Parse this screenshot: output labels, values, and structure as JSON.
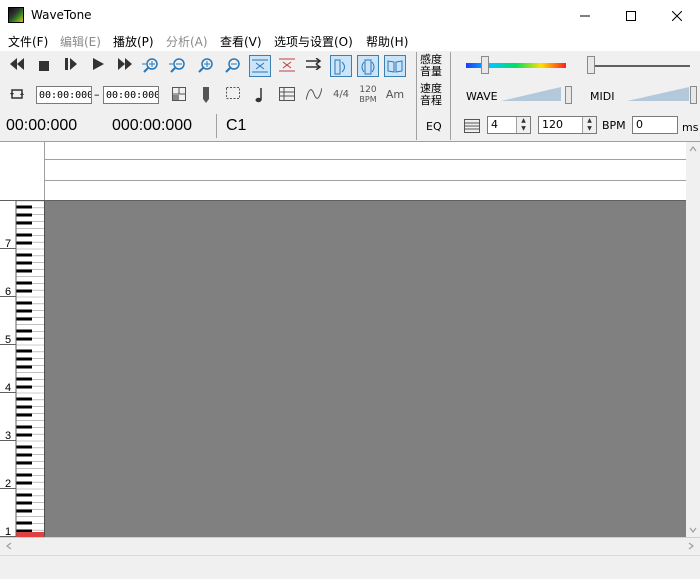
{
  "window": {
    "title": "WaveTone",
    "controls": [
      "minimize",
      "maximize",
      "close"
    ]
  },
  "menu": [
    {
      "label": "文件(F)",
      "enabled": true
    },
    {
      "label": "编辑(E)",
      "enabled": false
    },
    {
      "label": "播放(P)",
      "enabled": true
    },
    {
      "label": "分析(A)",
      "enabled": false
    },
    {
      "label": "查看(V)",
      "enabled": true
    },
    {
      "label": "选项与设置(O)",
      "enabled": true
    },
    {
      "label": "帮助(H)",
      "enabled": true
    }
  ],
  "toolbar": {
    "icons": [
      "rewind-icon",
      "stop-icon",
      "pause-play-icon",
      "play-icon",
      "fast-forward-icon",
      "zoom-in-horizontal-icon",
      "zoom-out-horizontal-icon",
      "zoom-in-vertical-icon",
      "zoom-out-vertical-icon",
      "fit-horizontal-icon",
      "fit-vertical-icon",
      "follow-icon",
      "speaker-left-icon",
      "speaker-both-icon",
      "book-icon"
    ],
    "loop_start": "00:00:000",
    "loop_end": "00:00:000",
    "separator": "–",
    "time_signature": "4/4",
    "tempo_icon_value": "120",
    "tempo_icon_unit": "BPM",
    "chord_label": "Am"
  },
  "display": {
    "position": "00:00:000",
    "length": "000:00:000",
    "note": "C1"
  },
  "right_panel": {
    "sensitivity_label": "感度",
    "volume_label": "音量",
    "speed_label": "速度",
    "pitch_label": "音程",
    "eq_label": "EQ",
    "wave_label": "WAVE",
    "midi_label": "MIDI",
    "beats_value": "4",
    "bpm_value": "120",
    "bpm_label": "BPM",
    "offset_value": "0",
    "ms_label": "ms"
  },
  "piano": {
    "octave_labels": [
      "7",
      "6",
      "5",
      "4",
      "3",
      "2",
      "1"
    ]
  },
  "colors": {
    "accent": "#3c7fb1",
    "roll_background": "#808080",
    "playhead_key": "#e04040"
  }
}
